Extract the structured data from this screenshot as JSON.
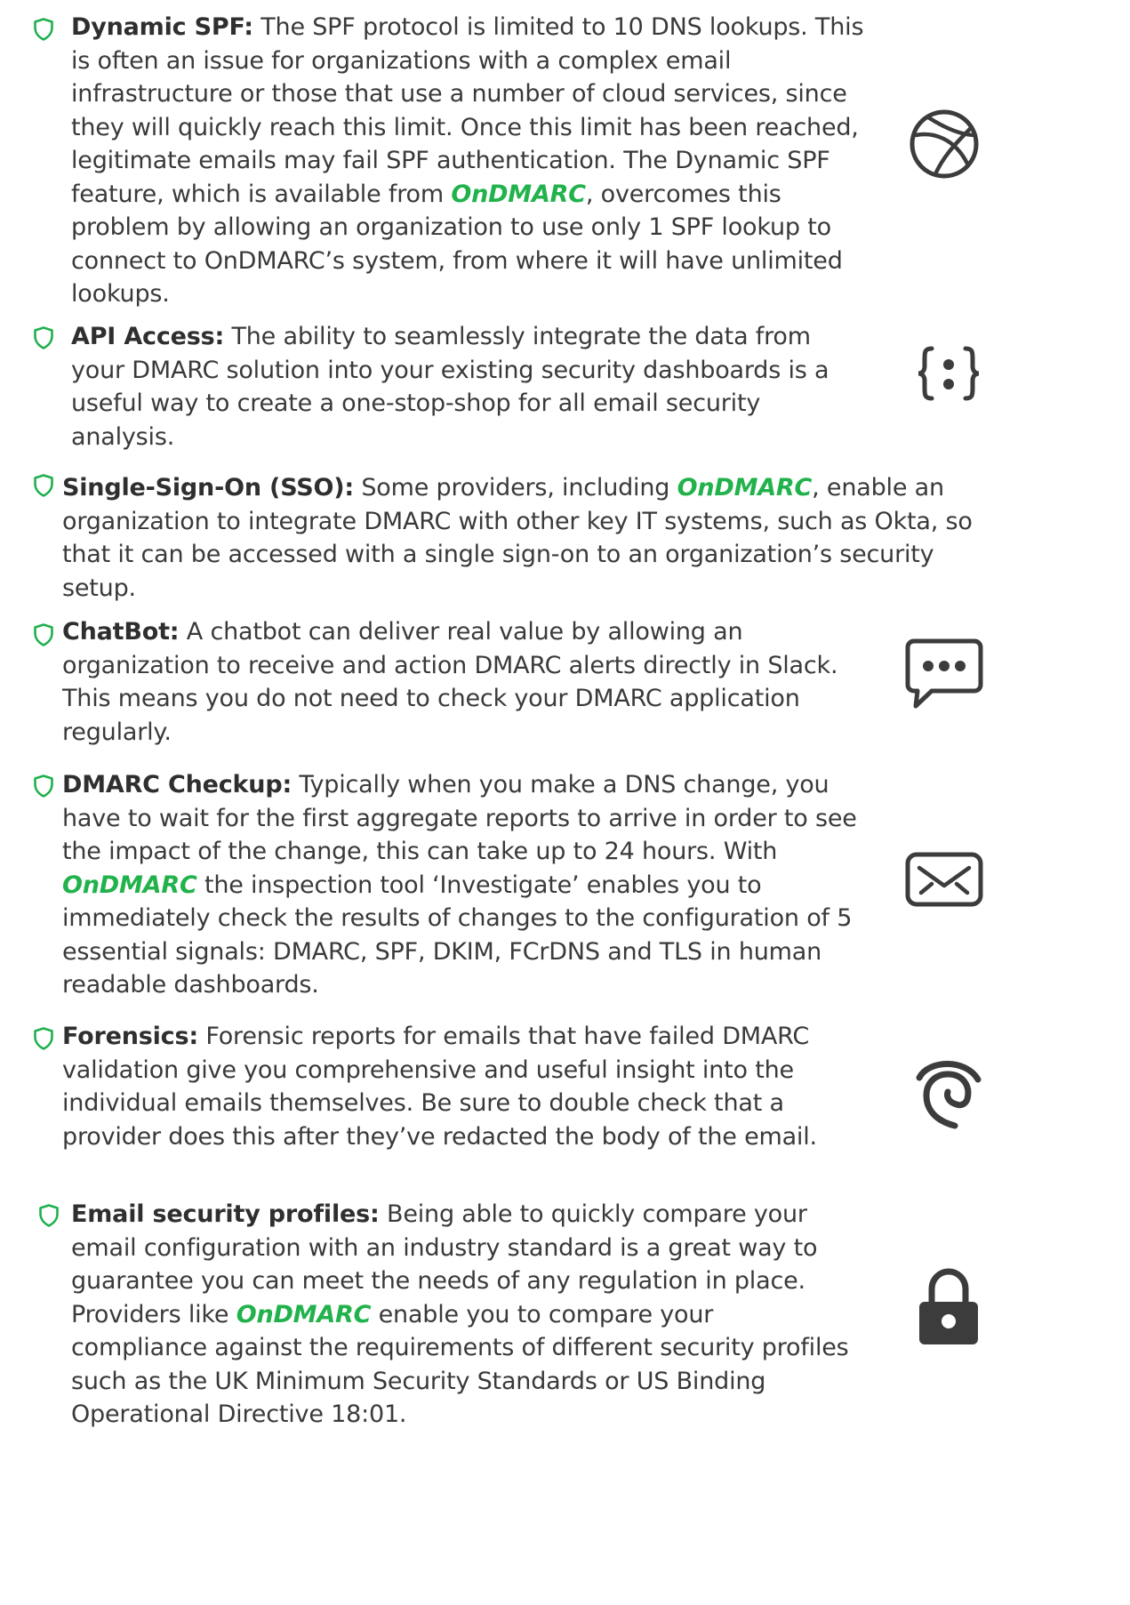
{
  "colors": {
    "shield": "#1fb04d",
    "brand": "#22b24c",
    "text": "#3a3a3a",
    "icon": "#3c3c3c"
  },
  "items": [
    {
      "icon": "shield-icon",
      "side_icon": "globe-icon",
      "label": "Dynamic SPF:",
      "segments": [
        " The SPF protocol is limited to 10 DNS lookups.  This is often an issue for organizations with a complex email infrastructure or those that use a number of cloud services, since they will quickly reach this limit.  Once this limit has been reached, legitimate emails may fail SPF authentication. The Dynamic SPF feature, which is available from ",
        "OnDMARC",
        ", overcomes this problem by allowing an organization to use only 1 SPF lookup to connect to OnDMARC’s system, from where it will have unlimited lookups."
      ]
    },
    {
      "icon": "shield-icon",
      "side_icon": "api-braces-icon",
      "label": "API Access:",
      "segments": [
        " The ability to seamlessly integrate the data from your DMARC solution into your existing security dashboards is a useful way to create a one-stop-shop for all email security analysis."
      ]
    },
    {
      "icon": "shield-icon",
      "side_icon": "",
      "label": "Single-Sign-On (SSO):",
      "segments": [
        " Some providers, including ",
        "OnDMARC",
        ", enable an organization to integrate DMARC with other key IT systems, such as Okta, so that it can be accessed with a single sign-on to an organization’s security setup."
      ]
    },
    {
      "icon": "shield-icon",
      "side_icon": "chat-bubble-icon",
      "label": "ChatBot:",
      "segments": [
        " A chatbot can deliver real value by allowing an organization to receive and action DMARC alerts directly in Slack. This means you do not need to check your DMARC application regularly."
      ]
    },
    {
      "icon": "shield-icon",
      "side_icon": "envelope-icon",
      "label": "DMARC Checkup:",
      "segments": [
        " Typically when you make a DNS change, you have to wait for the first aggregate reports to arrive in order to see the impact of the change, this can take up to 24 hours. With ",
        "OnDMARC",
        " the inspection tool ‘Investigate’ enables you to immediately check the results of changes to the configuration of 5 essential signals: DMARC, SPF, DKIM, FCrDNS and TLS in human readable dashboards."
      ]
    },
    {
      "icon": "shield-icon",
      "side_icon": "fingerprint-icon",
      "label": "Forensics:",
      "segments": [
        " Forensic reports for emails that have failed DMARC validation give you comprehensive and useful insight into the individual emails themselves. Be sure to double check that a provider does this after they’ve redacted the body of the email."
      ]
    },
    {
      "icon": "shield-icon",
      "side_icon": "padlock-icon",
      "label": "Email security profiles:",
      "segments": [
        " Being able to quickly compare your email configuration with an industry standard is a great way to guarantee you can meet the needs of any regulation in place. Providers like ",
        "OnDMARC",
        " enable you to compare your compliance against the requirements of different security profiles such as the UK Minimum Security Standards or US Binding Operational Directive 18:01."
      ]
    }
  ]
}
